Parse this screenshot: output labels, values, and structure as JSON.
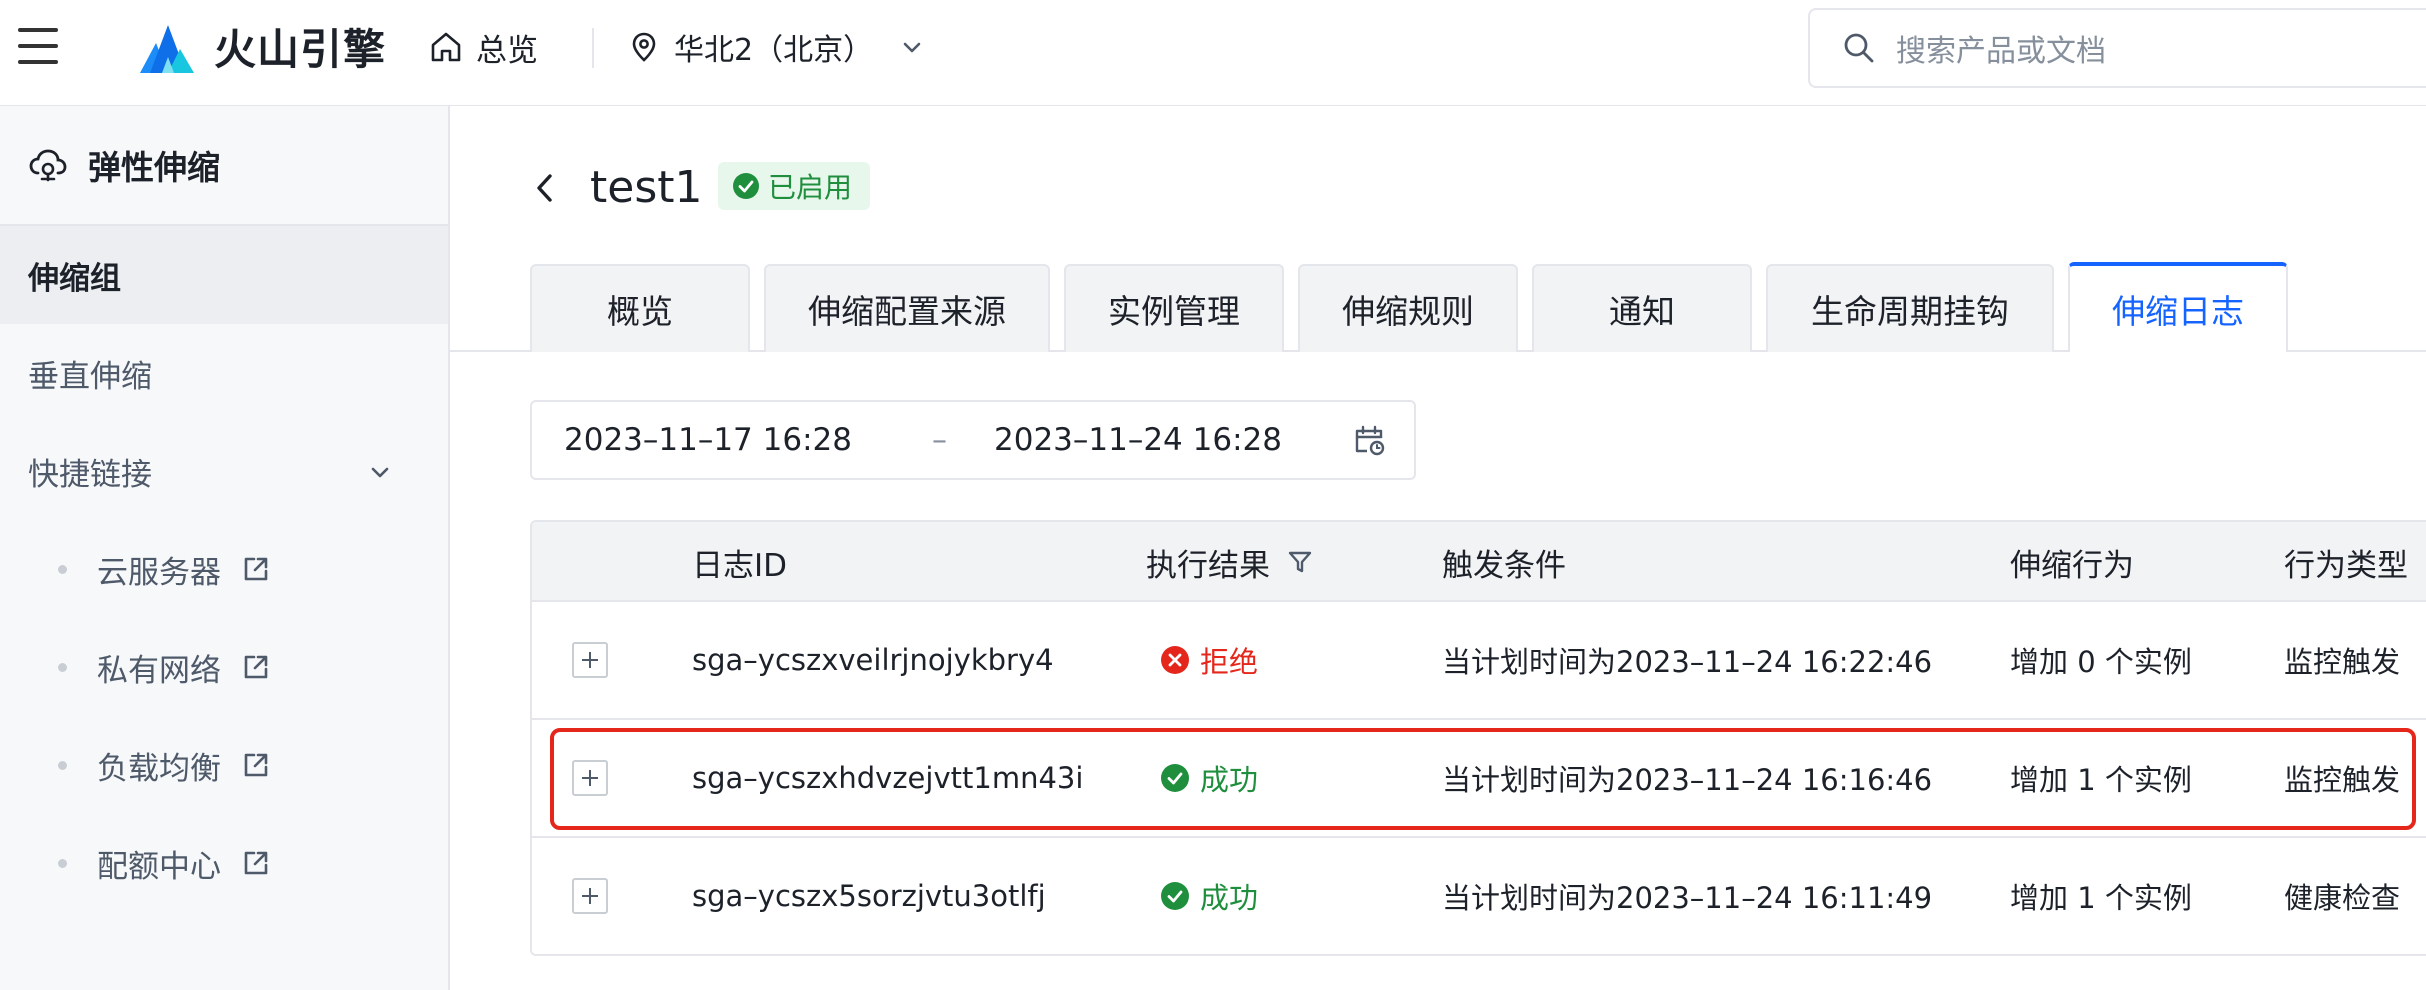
{
  "header": {
    "brand": "火山引擎",
    "home_label": "总览",
    "region_label": "华北2（北京）",
    "search_placeholder": "搜索产品或文档"
  },
  "sidebar": {
    "title": "弹性伸缩",
    "items": [
      {
        "label": "伸缩组",
        "active": true
      },
      {
        "label": "垂直伸缩",
        "active": false
      },
      {
        "label": "快捷链接",
        "active": false
      }
    ],
    "quick_links": [
      {
        "label": "云服务器"
      },
      {
        "label": "私有网络"
      },
      {
        "label": "负载均衡"
      },
      {
        "label": "配额中心"
      }
    ]
  },
  "page": {
    "title": "test1",
    "status_badge": "已启用"
  },
  "tabs": [
    {
      "label": "概览",
      "active": false
    },
    {
      "label": "伸缩配置来源",
      "active": false
    },
    {
      "label": "实例管理",
      "active": false
    },
    {
      "label": "伸缩规则",
      "active": false
    },
    {
      "label": "通知",
      "active": false
    },
    {
      "label": "生命周期挂钩",
      "active": false
    },
    {
      "label": "伸缩日志",
      "active": true
    }
  ],
  "date_range": {
    "start": "2023–11–17 16:28",
    "separator": "–",
    "end": "2023–11–24 16:28"
  },
  "table": {
    "columns": [
      "日志ID",
      "执行结果",
      "触发条件",
      "伸缩行为",
      "行为类型"
    ],
    "rows": [
      {
        "log_id": "sga–ycszxveilrjnojykbry4",
        "result": "拒绝",
        "result_type": "fail",
        "trigger": "当计划时间为2023–11–24 16:22:46",
        "action": "增加 0 个实例",
        "action_type": "监控触发"
      },
      {
        "log_id": "sga–ycszxhdvzejvtt1mn43i",
        "result": "成功",
        "result_type": "ok",
        "trigger": "当计划时间为2023–11–24 16:16:46",
        "action": "增加 1 个实例",
        "action_type": "监控触发"
      },
      {
        "log_id": "sga–ycszx5sorzjvtu3otlfj",
        "result": "成功",
        "result_type": "ok",
        "trigger": "当计划时间为2023–11–24 16:11:49",
        "action": "增加 1 个实例",
        "action_type": "健康检查"
      }
    ]
  },
  "colors": {
    "accent": "#1664ff",
    "success": "#1f8f3e",
    "danger": "#e5271b",
    "highlight_box": "#e5271b"
  }
}
